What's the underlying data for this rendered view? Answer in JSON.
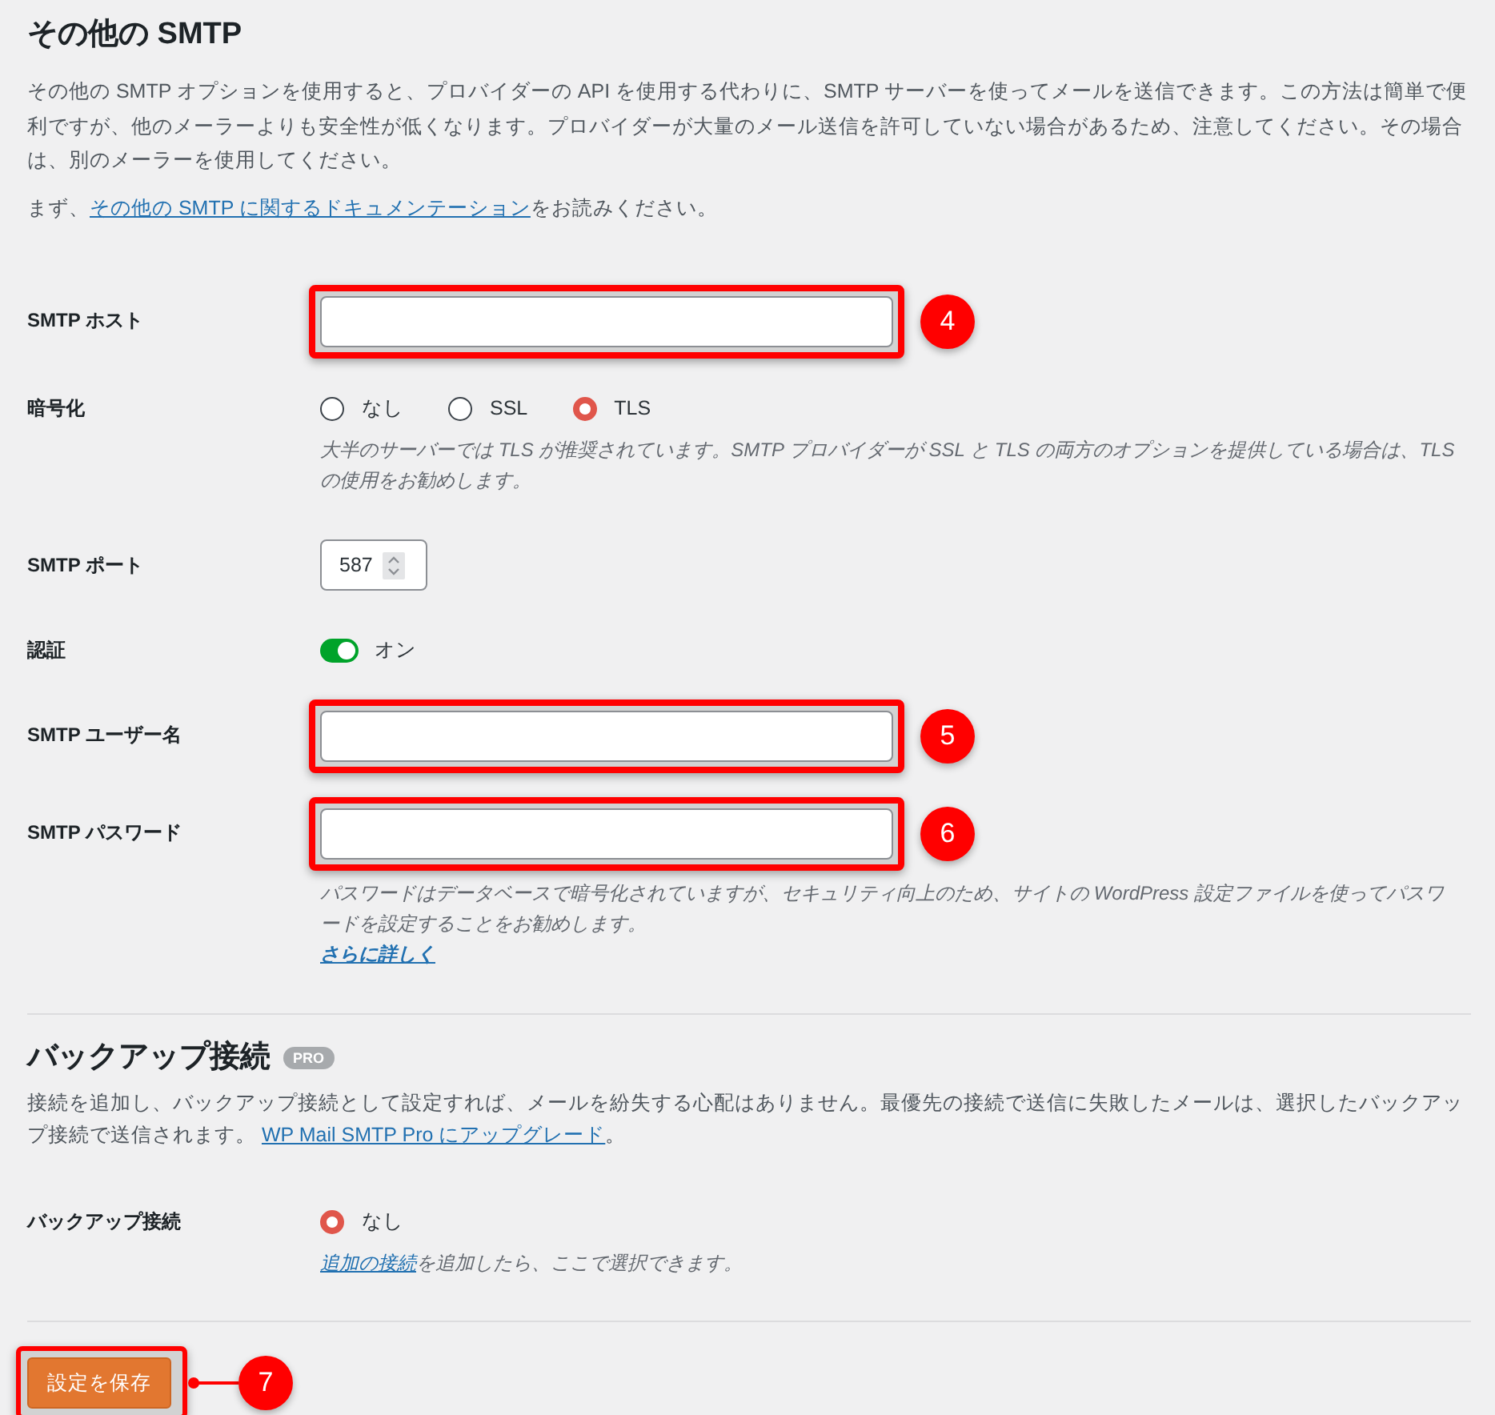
{
  "section": {
    "title": "その他の SMTP",
    "description": "その他の SMTP オプションを使用すると、プロバイダーの API を使用する代わりに、SMTP サーバーを使ってメールを送信できます。この方法は簡単で便利ですが、他のメーラーよりも安全性が低くなります。プロバイダーが大量のメール送信を許可していない場合があるため、注意してください。その場合は、別のメーラーを使用してください。",
    "doc_note": {
      "before": "まず、",
      "link": "その他の SMTP に関するドキュメンテーション",
      "after": "をお読みください。"
    }
  },
  "fields": [
    {
      "kind": "text",
      "label": "SMTP ホスト",
      "callout": "4"
    },
    {
      "kind": "radio",
      "label": "暗号化",
      "options": [
        {
          "label": "なし",
          "selected": false
        },
        {
          "label": "SSL",
          "selected": false
        },
        {
          "label": "TLS",
          "selected": true
        }
      ],
      "help": "大半のサーバーでは TLS が推奨されています。SMTP プロバイダーが SSL と TLS の両方のオプションを提供している場合は、TLS の使用をお勧めします。"
    },
    {
      "kind": "number",
      "label": "SMTP ポート",
      "value": "587"
    },
    {
      "kind": "toggle",
      "label": "認証",
      "on": true,
      "state_label": "オン"
    },
    {
      "kind": "text",
      "label": "SMTP ユーザー名",
      "callout": "5"
    },
    {
      "kind": "text",
      "label": "SMTP パスワード",
      "callout": "6",
      "help": "パスワードはデータベースで暗号化されていますが、セキュリティ向上のため、サイトの WordPress 設定ファイルを使ってパスワードを設定することをお勧めします。",
      "help_link": "さらに詳しく"
    }
  ],
  "backup": {
    "title": "バックアップ接続",
    "badge": "PRO",
    "description": "接続を追加し、バックアップ接続として設定すれば、メールを紛失する心配はありません。最優先の接続で送信に失敗したメールは、選択したバックアップ接続で送信されます。",
    "link": "WP Mail SMTP Pro にアップグレード",
    "after_link": "。",
    "field": {
      "label": "バックアップ接続",
      "options": [
        {
          "label": "なし",
          "selected": true
        }
      ],
      "help_link": "追加の接続",
      "help": "を追加したら、ここで選択できます。"
    }
  },
  "save_button": {
    "label": "設定を保存",
    "callout": "7"
  }
}
